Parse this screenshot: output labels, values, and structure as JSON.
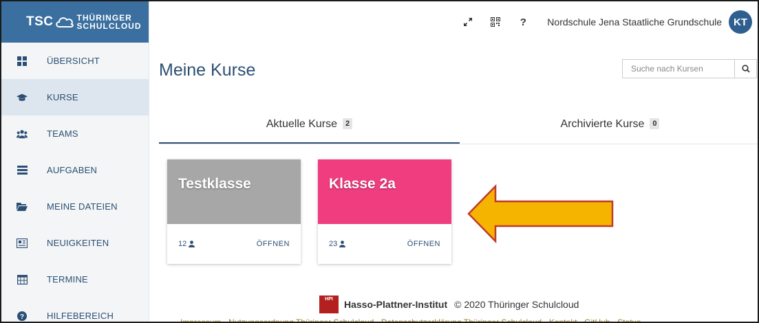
{
  "brand": {
    "short": "TSC",
    "line1": "THÜRINGER",
    "line2": "SCHULCLOUD"
  },
  "sidebar": {
    "items": [
      {
        "label": "ÜBERSICHT",
        "icon": "dashboard-icon",
        "active": false
      },
      {
        "label": "KURSE",
        "icon": "graduation-cap-icon",
        "active": true
      },
      {
        "label": "TEAMS",
        "icon": "users-icon",
        "active": false
      },
      {
        "label": "AUFGABEN",
        "icon": "tasks-icon",
        "active": false
      },
      {
        "label": "MEINE DATEIEN",
        "icon": "folder-icon",
        "active": false
      },
      {
        "label": "NEUIGKEITEN",
        "icon": "newspaper-icon",
        "active": false
      },
      {
        "label": "TERMINE",
        "icon": "calendar-icon",
        "active": false
      },
      {
        "label": "HILFEBEREICH",
        "icon": "help-icon",
        "active": false
      }
    ]
  },
  "topbar": {
    "help_symbol": "?",
    "school": "Nordschule Jena Staatliche Grundschule",
    "avatar_initials": "KT"
  },
  "main": {
    "title": "Meine Kurse",
    "search_placeholder": "Suche nach Kursen",
    "tabs": [
      {
        "label": "Aktuelle Kurse",
        "count": "2",
        "active": true
      },
      {
        "label": "Archivierte Kurse",
        "count": "0",
        "active": false
      }
    ],
    "courses": [
      {
        "name": "Testklasse",
        "members": "12",
        "action": "ÖFFNEN",
        "color": "#a7a7a7"
      },
      {
        "name": "Klasse 2a",
        "members": "23",
        "action": "ÖFFNEN",
        "color": "#ef3d7f"
      }
    ]
  },
  "annotation": {
    "arrow_color": "#f5b400",
    "arrow_border": "#c0392b"
  },
  "footer": {
    "logo_text": "HPI",
    "institute": "Hasso-Plattner-Institut",
    "copyright": "© 2020 Thüringer Schulcloud",
    "links": "Impressum · Nutzungsordnung Thüringer Schulcloud · Datenschutzerklärung Thüringer Schulcloud · Kontakt · GitHub · Status"
  },
  "colors": {
    "primary": "#2b4f73",
    "logo_bg": "#3a6f9f",
    "avatar_bg": "#2f5f8f"
  }
}
